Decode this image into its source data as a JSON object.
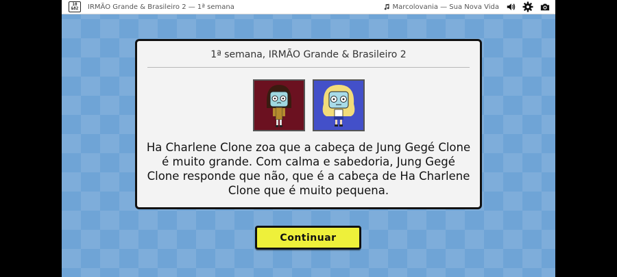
{
  "topbar": {
    "logo_line1": "10",
    "logo_line2": "&82",
    "window_title": "IRMÃO Grande & Brasileiro 2 — 1ª semana",
    "music_track": "Marcolovania — Sua Nova Vida",
    "icons": [
      "music-note-icon",
      "volume-icon",
      "gear-icon",
      "camera-icon"
    ]
  },
  "card": {
    "title": "1ª semana, IRMÃO Grande & Brasileiro 2",
    "message": "Ha Charlene Clone zoa que a cabeça de Jung Gegé Clone é muito grande. Com calma e sabedoria, Jung Gegé Clone responde que não, que é a cabeça de Ha Charlene Clone que é muito pequena."
  },
  "portraits": [
    {
      "background": "#6b1120"
    },
    {
      "background": "#4350c9"
    }
  ],
  "continue_button": {
    "label": "Continuar",
    "color": "#eef03a"
  }
}
